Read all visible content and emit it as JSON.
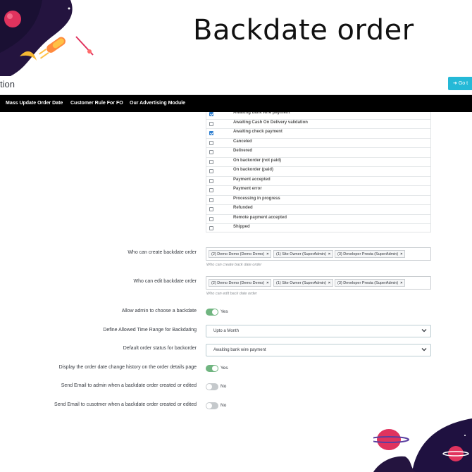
{
  "page": {
    "title": "Backdate order"
  },
  "admin": {
    "header_title": "tion",
    "go_button": "Go t",
    "nav": [
      "Mass Update Order Date",
      "Customer Rule For FO",
      "Our Advertising Module"
    ]
  },
  "statuses": [
    {
      "label": "Awaiting bank wire payment",
      "checked": true
    },
    {
      "label": "Awaiting Cash On Delivery validation",
      "checked": false
    },
    {
      "label": "Awaiting check payment",
      "checked": true
    },
    {
      "label": "Canceled",
      "checked": false
    },
    {
      "label": "Delivered",
      "checked": false
    },
    {
      "label": "On backorder (not paid)",
      "checked": false
    },
    {
      "label": "On backorder (paid)",
      "checked": false
    },
    {
      "label": "Payment accepted",
      "checked": false
    },
    {
      "label": "Payment error",
      "checked": false
    },
    {
      "label": "Processing in progress",
      "checked": false
    },
    {
      "label": "Refunded",
      "checked": false
    },
    {
      "label": "Remote payment accepted",
      "checked": false
    },
    {
      "label": "Shipped",
      "checked": false
    }
  ],
  "form": {
    "create_label": "Who can create backdate order",
    "create_tags": [
      "(2) Demo Demo (Demo Demo)",
      "(1) Site Owner (SuperAdmin)",
      "(3) Developer Presta (SuperAdmin)"
    ],
    "create_help": "Who can create back date order",
    "edit_label": "Who can edit backdate order",
    "edit_tags": [
      "(2) Demo Demo (Demo Demo)",
      "(1) Site Owner (SuperAdmin)",
      "(3) Developer Presta (SuperAdmin)"
    ],
    "edit_help": "Who can edit back date order",
    "allow_admin_label": "Allow admin to choose a backdate",
    "allow_admin_value": "Yes",
    "time_range_label": "Define Allowed Time Range for Backdating",
    "time_range_value": "Upto a Month",
    "default_status_label": "Default order status for backorder",
    "default_status_value": "Awaiting bank wire payment",
    "display_history_label": "Display the order date change history on the order details page",
    "display_history_value": "Yes",
    "email_admin_label": "Send Email to admin when a backdate order created or edited",
    "email_admin_value": "No",
    "email_customer_label": "Send Email to cusotmer when a backdate order created or edited",
    "email_customer_value": "No"
  },
  "colors": {
    "accent": "#25b9d7",
    "switch_on": "#70b580",
    "switch_off": "#c5c9cc",
    "checkbox": "#2f7fd0",
    "navbar": "#000000"
  },
  "icons": {
    "go_button": "circle-arrow-icon",
    "select": "chevron-down-icon",
    "tag_remove": "close-icon"
  }
}
